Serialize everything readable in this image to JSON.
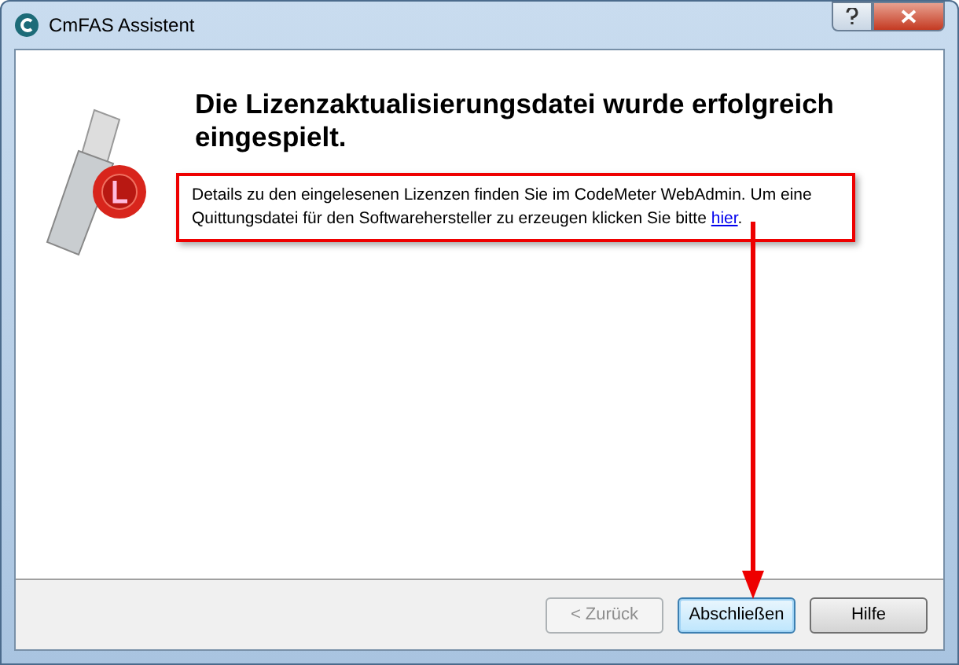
{
  "window": {
    "title": "CmFAS Assistent"
  },
  "heading": "Die Lizenzaktualisierungsdatei wurde erfolgreich eingespielt.",
  "description": {
    "text": "Details zu den eingelesenen Lizenzen finden Sie im CodeMeter WebAdmin. Um eine Quittungsdatei für den Softwarehersteller zu erzeugen klicken Sie bitte ",
    "link": "hier",
    "end": "."
  },
  "buttons": [
    {
      "label": "< Zurück",
      "disabled": true,
      "selected": false
    },
    {
      "label": "Abschließen",
      "disabled": false,
      "selected": true
    },
    {
      "label": "Hilfe",
      "disabled": false,
      "selected": false
    }
  ]
}
